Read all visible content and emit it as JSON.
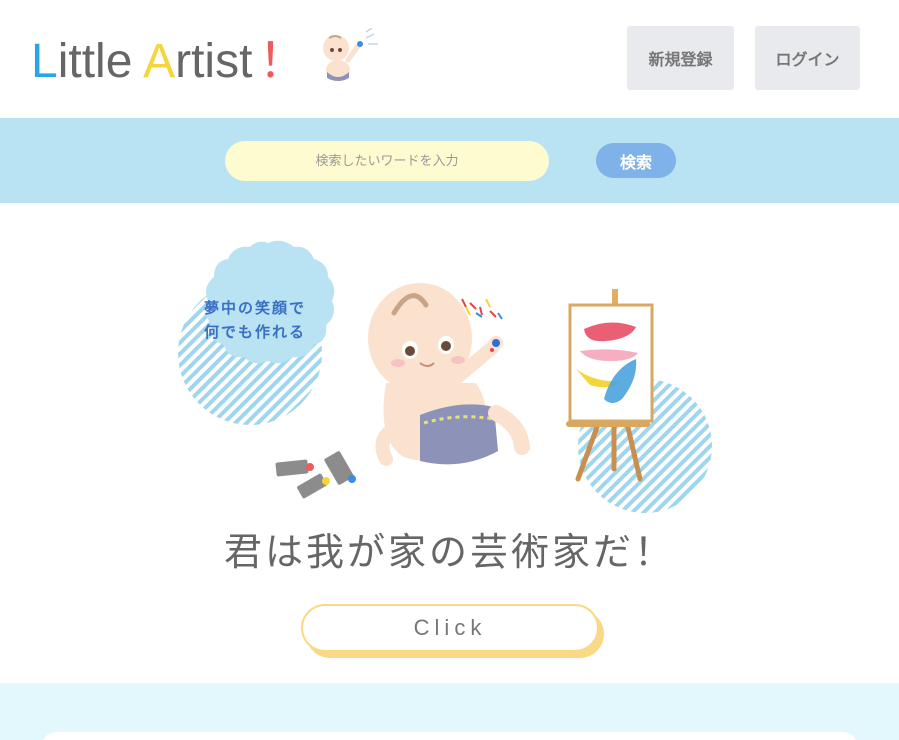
{
  "header": {
    "logo": {
      "letter_l": "L",
      "rest_1": "ittle ",
      "letter_a": "A",
      "rest_2": "rtist",
      "exclaim": "！"
    },
    "register_label": "新規登録",
    "login_label": "ログイン"
  },
  "search": {
    "placeholder": "検索したいワードを入力",
    "button_label": "検索"
  },
  "hero": {
    "bubble_line_1": "夢中の笑顔で",
    "bubble_line_2": "何でも作れる",
    "headline": "君は我が家の芸術家だ！",
    "cta_label": "Click"
  },
  "colors": {
    "logo_l": "#2aa6e8",
    "logo_a": "#f4d63c",
    "logo_exclaim": "#f05a5a",
    "search_band": "#b9e3f2",
    "search_input_bg": "#fffbd1",
    "search_button": "#7fb2e8",
    "cta_border": "#f9d984",
    "bottom_band": "#e3f8fd"
  },
  "icons": [
    "baby-logo-icon",
    "baby-painting-illustration",
    "easel-illustration",
    "paint-tubes-illustration"
  ]
}
